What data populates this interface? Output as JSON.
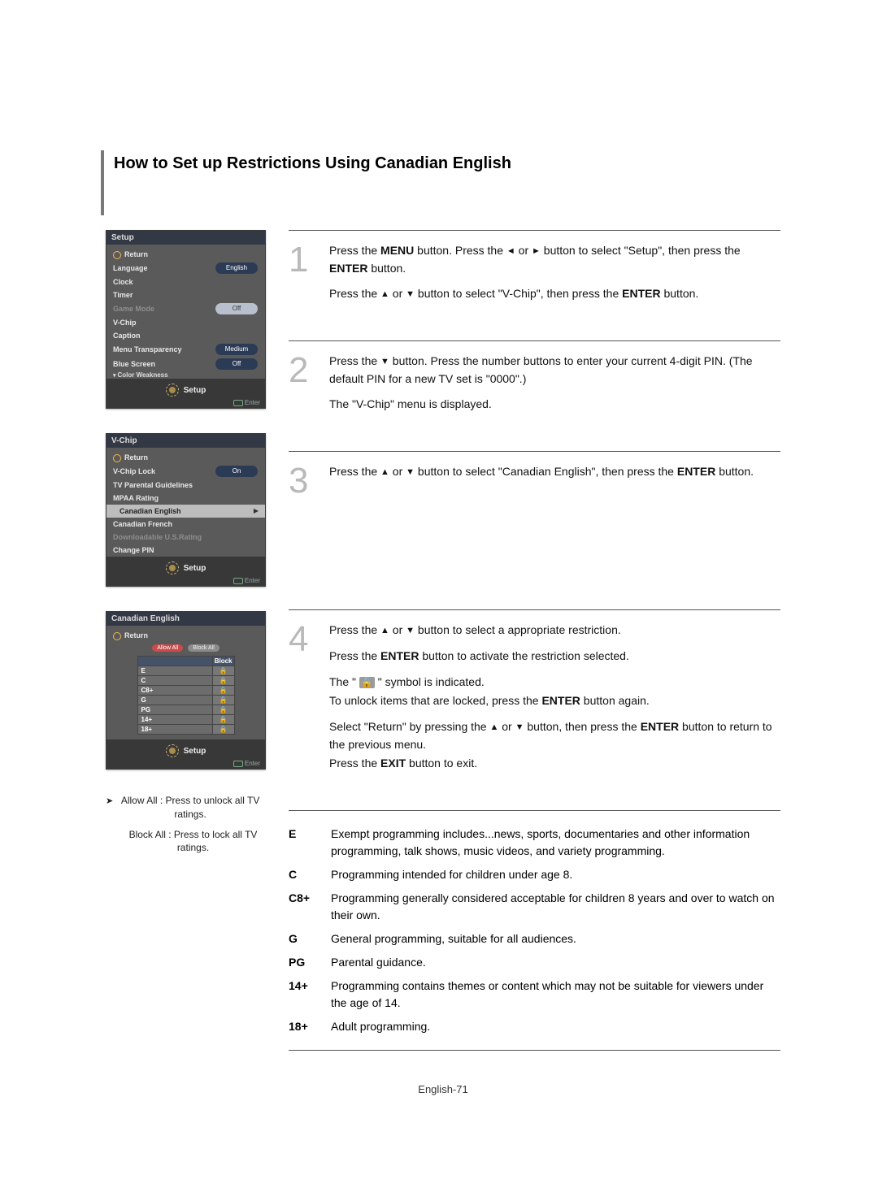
{
  "page": {
    "title": "How to Set up Restrictions Using Canadian English",
    "footer": "English-71"
  },
  "osd": {
    "panel1": {
      "title": "Setup",
      "return": "Return",
      "rows": {
        "language_l": "Language",
        "language_v": "English",
        "clock_l": "Clock",
        "timer_l": "Timer",
        "gamemode_l": "Game Mode",
        "gamemode_v": "Off",
        "vchip_l": "V-Chip",
        "caption_l": "Caption",
        "mtrans_l": "Menu Transparency",
        "mtrans_v": "Medium",
        "bluescreen_l": "Blue Screen",
        "bluescreen_v": "Off",
        "colorweak_l": "Color Weakness"
      },
      "footer_label": "Setup",
      "enter_hint": "Enter"
    },
    "panel2": {
      "title": "V-Chip",
      "return": "Return",
      "rows": {
        "lock_l": "V-Chip Lock",
        "lock_v": "On",
        "tvpg_l": "TV Parental Guidelines",
        "mpaa_l": "MPAA Rating",
        "caneng_l": "Canadian English",
        "canfr_l": "Canadian French",
        "dlus_l": "Downloadable U.S.Rating",
        "changepin_l": "Change PIN"
      },
      "footer_label": "Setup",
      "enter_hint": "Enter"
    },
    "panel3": {
      "title": "Canadian English",
      "return": "Return",
      "allow": "Allow All",
      "block": "Block All",
      "block_header": "Block",
      "rows": {
        "e": "E",
        "c": "C",
        "c8": "C8+",
        "g": "G",
        "pg": "PG",
        "p14": "14+",
        "p18": "18+"
      },
      "footer_label": "Setup",
      "enter_hint": "Enter"
    }
  },
  "notes": {
    "allow_all": "Allow All : Press to unlock all TV ratings.",
    "block_all": "Block All : Press to lock all TV ratings."
  },
  "steps": {
    "s1": {
      "a1": "Press the ",
      "a2": "MENU",
      "a3": " button. Press the ",
      "a4": " or ",
      "a5": " button to select \"Setup\", then press  the ",
      "a6": "ENTER",
      "a7": " button.",
      "b1": "Press the ",
      "b2": " or ",
      "b3": " button to select \"V-Chip\", then press the ",
      "b4": "ENTER",
      "b5": " button."
    },
    "s2": {
      "a1": "Press the ",
      "a2": " button. Press the number buttons to enter your current 4-digit PIN. (The default PIN for a new TV set is \"0000\".)",
      "b1": "The \"V-Chip\" menu is displayed."
    },
    "s3": {
      "a1": "Press the ",
      "a2": " or ",
      "a3": " button to select \"Canadian English\", then press the ",
      "a4": "ENTER",
      "a5": " button."
    },
    "s4": {
      "a1": "Press the ",
      "a2": " or ",
      "a3": " button to select a appropriate restriction.",
      "b1": "Press the ",
      "b2": "ENTER",
      "b3": " button to activate the restriction selected.",
      "c1": "The \" ",
      "c2": " \" symbol is indicated.",
      "d1": "To unlock items that are locked, press the ",
      "d2": "ENTER",
      "d3": " button again.",
      "e1": "Select \"Return\" by pressing the ",
      "e2": " or ",
      "e3": " button, then press the ",
      "e4": "ENTER",
      "e5": " button to return to the previous menu.",
      "f1": "Press the ",
      "f2": "EXIT",
      "f3": " button to exit."
    }
  },
  "ratings": {
    "E": {
      "code": "E",
      "desc": "Exempt programming includes...news, sports, documentaries and other information programming, talk shows, music videos, and variety programming."
    },
    "C": {
      "code": "C",
      "desc": "Programming intended for children under age 8."
    },
    "C8": {
      "code": "C8+",
      "desc": "Programming generally considered acceptable for children 8 years and over to watch on their own."
    },
    "G": {
      "code": "G",
      "desc": "General programming, suitable for all audiences."
    },
    "PG": {
      "code": "PG",
      "desc": "Parental guidance."
    },
    "R14": {
      "code": "14+",
      "desc": "Programming contains themes or content which may not be suitable for viewers under the age of 14."
    },
    "R18": {
      "code": "18+",
      "desc": "Adult programming."
    }
  }
}
